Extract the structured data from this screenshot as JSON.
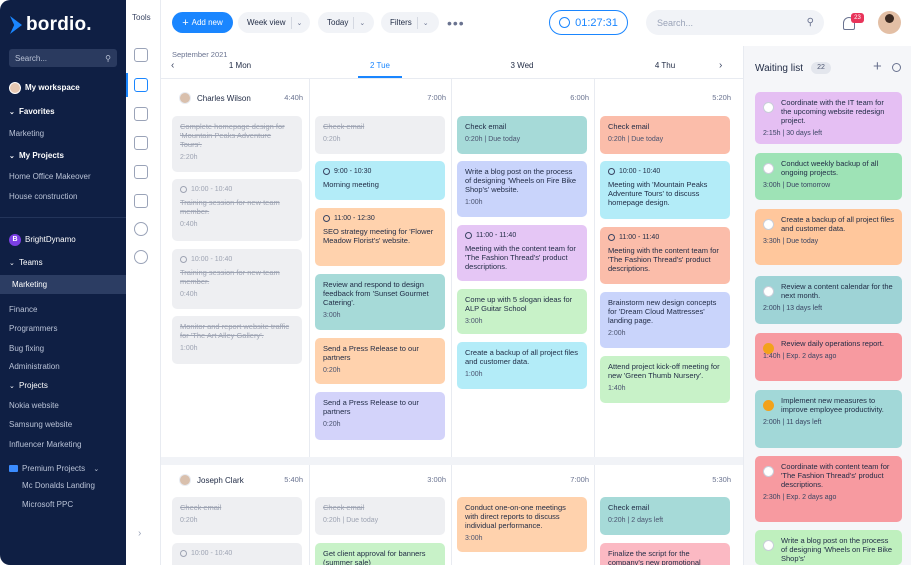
{
  "sidebar": {
    "brand": "bordio.",
    "search_placeholder": "Search...",
    "workspace": "My workspace",
    "favorites": "Favorites",
    "fav_marketing": "Marketing",
    "my_projects": "My Projects",
    "proj_home": "Home Office Makeover",
    "proj_house": "House construction",
    "org_initial": "B",
    "org_name": "BrightDynamo",
    "teams": "Teams",
    "team_marketing": "Marketing",
    "team_finance": "Finance",
    "team_programmers": "Programmers",
    "team_bugfixing": "Bug fixing",
    "team_admin": "Administration",
    "projects": "Projects",
    "p_nokia": "Nokia website",
    "p_samsung": "Samsung website",
    "p_influencer": "Influencer Marketing",
    "premium": "Premium Projects",
    "p_mcd": "Mc Donalds Landing",
    "p_msppc": "Microsoft PPC"
  },
  "tools": {
    "title": "Tools"
  },
  "toolbar": {
    "add_new": "Add new",
    "week_view": "Week view",
    "today": "Today",
    "filters": "Filters",
    "timer": "01:27:31",
    "search_placeholder": "Search...",
    "notifications": "23"
  },
  "calendar": {
    "month": "September 2021",
    "days": [
      "1 Mon",
      "2 Tue",
      "3 Wed",
      "4 Thu"
    ],
    "people": [
      {
        "name": "Charles Wilson",
        "total": "4:40h",
        "day_totals": [
          "7:00h",
          "6:00h",
          "5:20h"
        ]
      },
      {
        "name": "Joseph Clark",
        "total": "5:40h",
        "day_totals": [
          "3:00h",
          "7:00h",
          "5:30h"
        ]
      }
    ]
  },
  "tasks": {
    "cw_mon_1": {
      "title": "Complete homepage design for 'Mountain Peaks Adventure Tours'.",
      "meta": "2:20h"
    },
    "cw_mon_2": {
      "time": "10:00 - 10:40",
      "title": "Training session for new team member.",
      "meta": "0:40h"
    },
    "cw_mon_3": {
      "time": "10:00 - 10:40",
      "title": "Training session for new team member.",
      "meta": "0:40h"
    },
    "cw_mon_4": {
      "title": "Monitor and report website traffic for 'The Art Alley Gallery'.",
      "meta": "1:00h"
    },
    "cw_tue_1": {
      "title": "Check email",
      "meta": "0:20h"
    },
    "cw_tue_2": {
      "time": "9:00 - 10:30",
      "title": "Morning meeting"
    },
    "cw_tue_3": {
      "time": "11:00 - 12:30",
      "title": "SEO strategy meeting for 'Flower Meadow Florist's' website."
    },
    "cw_tue_4": {
      "title": "Review and respond to design feedback from 'Sunset Gourmet Catering'.",
      "meta": "3:00h"
    },
    "cw_tue_5": {
      "title": "Send a Press Release to our partners",
      "meta": "0:20h"
    },
    "cw_tue_6": {
      "title": "Send a Press Release to our partners",
      "meta": "0:20h"
    },
    "cw_wed_1": {
      "title": "Check email",
      "meta": "0:20h | Due today"
    },
    "cw_wed_2": {
      "title": "Write a blog post on the process of designing 'Wheels on Fire Bike Shop's' website.",
      "meta": "1:00h"
    },
    "cw_wed_3": {
      "time": "11:00 - 11:40",
      "title": "Meeting with the content team for 'The Fashion Thread's' product descriptions."
    },
    "cw_wed_4": {
      "title": "Come up with 5 slogan ideas for ALP Guitar School",
      "meta": "3:00h"
    },
    "cw_wed_5": {
      "title": "Create a backup of all project files and customer data.",
      "meta": "1:00h"
    },
    "cw_thu_1": {
      "title": "Check email",
      "meta": "0:20h | Due today"
    },
    "cw_thu_2": {
      "time": "10:00 - 10:40",
      "title": "Meeting with 'Mountain Peaks Adventure Tours' to discuss homepage design."
    },
    "cw_thu_3": {
      "time": "11:00 - 11:40",
      "title": "Meeting with the content team for 'The Fashion Thread's' product descriptions."
    },
    "cw_thu_4": {
      "title": "Brainstorm new design concepts for 'Dream Cloud Mattresses' landing page.",
      "meta": "2:00h"
    },
    "cw_thu_5": {
      "title": "Attend project kick-off meeting for new 'Green Thumb Nursery'.",
      "meta": "1:40h"
    },
    "jc_mon_1": {
      "title": "Check email",
      "meta": "0:20h"
    },
    "jc_mon_2": {
      "time": "10:00 - 10:40"
    },
    "jc_tue_1": {
      "title": "Check email",
      "meta": "0:20h | Due today"
    },
    "jc_tue_2": {
      "title": "Get client approval for banners (summer sale)"
    },
    "jc_wed_1": {
      "title": "Conduct one-on-one meetings with direct reports to discuss individual performance.",
      "meta": "3:00h"
    },
    "jc_thu_1": {
      "title": "Check email",
      "meta": "0:20h | 2 days left"
    },
    "jc_thu_2": {
      "title": "Finalize the script for the company's new promotional video."
    }
  },
  "waiting_list": {
    "title": "Waiting list",
    "count": "22",
    "items": [
      {
        "title": "Coordinate with the IT team for the upcoming website redesign project.",
        "meta": "2:15h | 30 days left"
      },
      {
        "title": "Conduct weekly backup of all ongoing projects.",
        "meta": "3:00h | Due tomorrow"
      },
      {
        "title": "Create a backup of all project files and customer data.",
        "meta": "3:30h | Due today"
      },
      {
        "title": "Review a content calendar for the next month.",
        "meta": "2:00h | 13 days left"
      },
      {
        "title": "Review daily operations report.",
        "meta": "1:40h | Exp. 2 days ago"
      },
      {
        "title": "Implement new measures to improve employee productivity.",
        "meta": "2:00h | 11 days left"
      },
      {
        "title": "Coordinate with content team for 'The Fashion Thread's' product descriptions.",
        "meta": "2:30h | Exp. 2 days ago"
      },
      {
        "title": "Write a blog post on the process of designing 'Wheels on Fire Bike Shop's'"
      }
    ]
  },
  "colors": {
    "accent": "#1a86ff",
    "sidebar": "#0f1f44"
  }
}
